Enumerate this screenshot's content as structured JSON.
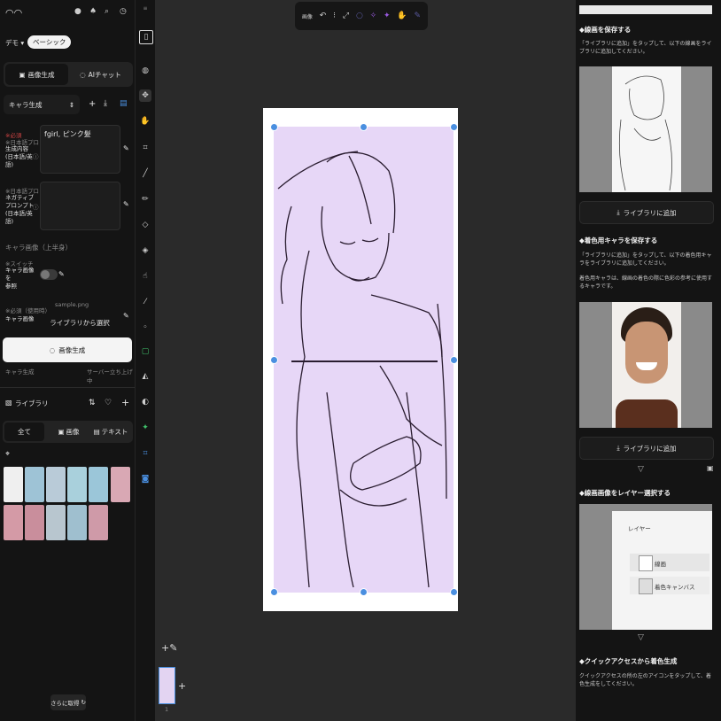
{
  "left_panel": {
    "project_label": "デモ",
    "plan_badge": "ベーシック",
    "tabs": {
      "image_gen": "画像生成",
      "ai_chat": "AIチャット"
    },
    "mode_select": "キャラ生成",
    "required_mark": "※必須",
    "ja_prompt_mark": "※日本語プロンプト",
    "prompt_label": "生成内容\n(日本語/英語)",
    "prompt_value": "fgirl, ピンク髪",
    "negative_label": "ネガティブ\nプロンプト\n(日本語/英語)",
    "negative_value": "",
    "char_image_section": "キャラ画像（上半身）",
    "switch_mark": "※スイッチ",
    "char_ref_label": "キャラ画像を\n参照",
    "upload_mark": "※必須（使用時）",
    "char_image_label": "キャラ画像",
    "file_name": "sample.png",
    "library_select": "ライブラリから選択",
    "generate_button": "画像生成",
    "status_left": "キャラ生成",
    "status_right": "サーバー立ち上げ中",
    "library_title": "ライブラリ",
    "filters": {
      "all": "全て",
      "image": "画像",
      "text": "テキスト"
    },
    "load_more": "さらに取得"
  },
  "top_toolbar": {
    "label": "画像"
  },
  "canvas": {
    "page_number": "1"
  },
  "right_panel": {
    "sec1_title": "◆線画を保存する",
    "sec1_text": "「ライブラリに追加」をタップして、以下の線画をライブラリに追加してください。",
    "add_library_1": "ライブラリに追加",
    "sec2_title": "◆着色用キャラを保存する",
    "sec2_text1": "「ライブラリに追加」をタップして、以下の着色用キャラをライブラリに追加してください。",
    "sec2_text2": "着色用キャラは、線画の着色の際に色彩の参考に使用するキャラです。",
    "add_library_2": "ライブラリに追加",
    "sec3_title": "◆線画画像をレイヤー選択する",
    "layer_panel_title": "レイヤー",
    "layer1": "線画",
    "layer2": "着色キャンバス",
    "sec4_title": "◆クイックアクセスから着色生成",
    "sec4_text": "クイックアクセスの所の左のアイコンをタップして、着色生成をしてください。"
  }
}
